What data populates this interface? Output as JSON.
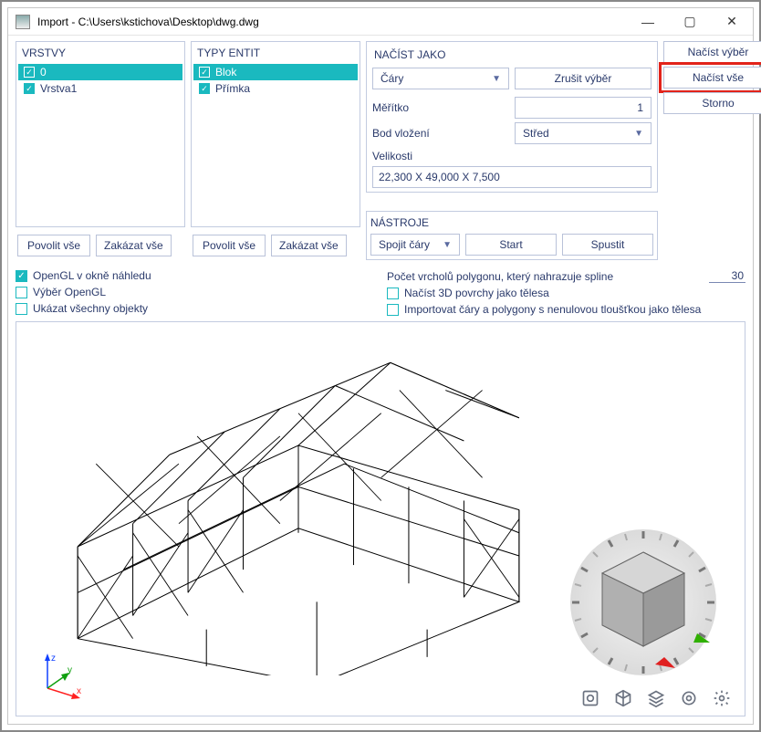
{
  "window": {
    "title": "Import - C:\\Users\\kstichova\\Desktop\\dwg.dwg",
    "controls": {
      "minimize": "—",
      "maximize": "▢",
      "close": "✕"
    }
  },
  "layers_panel": {
    "title": "VRSTVY",
    "items": [
      {
        "label": "0",
        "selected": true,
        "checked": true
      },
      {
        "label": "Vrstva1",
        "selected": false,
        "checked": true
      }
    ],
    "enable_all": "Povolit vše",
    "disable_all": "Zakázat vše"
  },
  "entities_panel": {
    "title": "TYPY ENTIT",
    "items": [
      {
        "label": "Blok",
        "selected": true,
        "checked": true
      },
      {
        "label": "Přímka",
        "selected": false,
        "checked": true
      }
    ],
    "enable_all": "Povolit vše",
    "disable_all": "Zakázat vše"
  },
  "load_panel": {
    "title": "NAČÍST JAKO",
    "type_combo": "Čáry",
    "cancel_selection": "Zrušit výběr",
    "scale_label": "Měřítko",
    "scale_value": "1",
    "insert_label": "Bod vložení",
    "insert_value": "Střed",
    "size_label": "Velikosti",
    "size_value": "22,300 X 49,000 X 7,500"
  },
  "side_buttons": {
    "load_selection": "Načíst výběr",
    "load_all": "Načíst vše",
    "cancel": "Storno"
  },
  "tools_panel": {
    "title": "NÁSTROJE",
    "combo": "Spojit čáry",
    "start": "Start",
    "run": "Spustit"
  },
  "opts": {
    "opengl_preview": "OpenGL v okně náhledu",
    "opengl_select": "Výběr OpenGL",
    "show_all": "Ukázat všechny objekty",
    "spline_label": "Počet vrcholů polygonu, který nahrazuje spline",
    "spline_value": "30",
    "load_3d_surfaces": "Načíst 3D povrchy jako tělesa",
    "import_lines_poly": "Importovat čáry a polygony s nenulovou tloušťkou jako tělesa"
  },
  "axes": {
    "x": "x",
    "y": "y",
    "z": "z"
  }
}
